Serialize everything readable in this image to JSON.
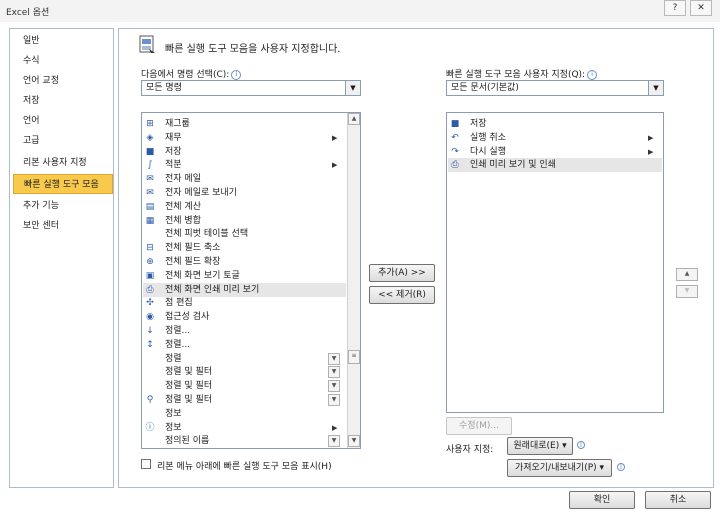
{
  "window": {
    "title": "Excel 옵션",
    "help_label": "?",
    "close_label": "✕"
  },
  "sidebar": {
    "items": [
      {
        "label": "일반"
      },
      {
        "label": "수식"
      },
      {
        "label": "언어 교정"
      },
      {
        "label": "저장"
      },
      {
        "label": "언어"
      },
      {
        "label": "고급"
      },
      {
        "label": "리본 사용자 지정"
      },
      {
        "label": "빠른 실행 도구 모음"
      },
      {
        "label": "추가 기능"
      },
      {
        "label": "보안 센터"
      }
    ],
    "selected": "빠른 실행 도구 모음"
  },
  "header": {
    "text": "빠른 실행 도구 모음을 사용자 지정합니다."
  },
  "commands": {
    "label": "다음에서 명령 선택(C):",
    "selected": "모든 명령",
    "items": [
      {
        "label": "재그룹",
        "icon": "regroup-icon",
        "sub": false
      },
      {
        "label": "재무",
        "icon": "finance-icon",
        "sub": true
      },
      {
        "label": "저장",
        "icon": "save-icon",
        "sub": false
      },
      {
        "label": "적분",
        "icon": "integral-icon",
        "sub": true
      },
      {
        "label": "전자 메일",
        "icon": "email-icon",
        "sub": false
      },
      {
        "label": "전자 메일로 보내기",
        "icon": "send-email-icon",
        "sub": false
      },
      {
        "label": "전체 계산",
        "icon": "calculate-icon",
        "sub": false
      },
      {
        "label": "전체 병합",
        "icon": "merge-icon",
        "sub": false
      },
      {
        "label": "전체 피벗 테이블 선택",
        "icon": "",
        "sub": false
      },
      {
        "label": "전체 필드 축소",
        "icon": "collapse-icon",
        "sub": false
      },
      {
        "label": "전체 필드 확장",
        "icon": "expand-icon",
        "sub": false
      },
      {
        "label": "전체 화면 보기 토글",
        "icon": "fullscreen-icon",
        "sub": false
      },
      {
        "label": "전체 화면 인쇄 미리 보기",
        "icon": "print-preview-icon",
        "sub": false,
        "highlight": true
      },
      {
        "label": "점 편집",
        "icon": "edit-points-icon",
        "sub": false
      },
      {
        "label": "접근성 검사",
        "icon": "accessibility-icon",
        "sub": false
      },
      {
        "label": "정렬...",
        "icon": "sort-icon",
        "sub": false
      },
      {
        "label": "정렬...",
        "icon": "sort-az-icon",
        "sub": false
      },
      {
        "label": "정렬",
        "icon": "",
        "sub": false,
        "dropdown": true
      },
      {
        "label": "정렬 및 필터",
        "icon": "",
        "sub": false,
        "dropdown": true
      },
      {
        "label": "정렬 및 필터",
        "icon": "",
        "sub": false,
        "dropdown": true
      },
      {
        "label": "정렬 및 필터",
        "icon": "sort-filter-icon",
        "sub": false,
        "dropdown": true
      },
      {
        "label": "정보",
        "icon": "",
        "sub": false
      },
      {
        "label": "정보",
        "icon": "info-icon",
        "sub": true
      },
      {
        "label": "정의된 이름",
        "icon": "",
        "sub": false,
        "dropdown": true
      }
    ]
  },
  "quick_access": {
    "label": "빠른 실행 도구 모음 사용자 지정(Q):",
    "selected": "모든 문서(기본값)",
    "items": [
      {
        "label": "저장",
        "icon": "save-icon",
        "sub": false
      },
      {
        "label": "실행 취소",
        "icon": "undo-icon",
        "sub": true
      },
      {
        "label": "다시 실행",
        "icon": "redo-icon",
        "sub": true
      },
      {
        "label": "인쇄 미리 보기 및 인쇄",
        "icon": "print-preview-icon",
        "sub": false,
        "highlight": true
      }
    ]
  },
  "buttons": {
    "add": "추가(A) >>",
    "remove": "<< 제거(R)",
    "modify": "수정(M)...",
    "customize_label": "사용자 지정:",
    "reset": "원래대로(E) ▾",
    "import_export": "가져오기/내보내기(P) ▾",
    "ok": "확인",
    "cancel": "취소"
  },
  "checkbox": {
    "label": "리본 메뉴 아래에 빠른 실행 도구 모음 표시(H)",
    "checked": false
  }
}
